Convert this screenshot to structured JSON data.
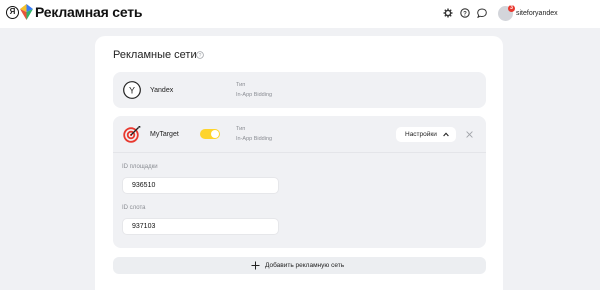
{
  "header": {
    "logo_letter": "Я",
    "title": "Рекламная сеть",
    "icons": [
      "gear-icon",
      "help-icon",
      "chat-icon"
    ],
    "avatar_badge": "3",
    "username": "siteforyandex"
  },
  "section": {
    "title": "Рекламные сети"
  },
  "networks": [
    {
      "logo_letter": "Y",
      "name": "Yandex",
      "type_label": "Тип",
      "type_value": "In-App Bidding"
    },
    {
      "name": "MyTarget",
      "enabled": true,
      "type_label": "Тип",
      "type_value": "In-App Bidding",
      "settings_label": "Настройки",
      "fields": [
        {
          "label": "ID площадки",
          "value": "936510"
        },
        {
          "label": "ID слота",
          "value": "937103"
        }
      ]
    }
  ],
  "add_button": {
    "label": "Добавить рекламную сеть"
  },
  "colors": {
    "toggle_on": "#fed42b",
    "background": "#f0f1f4",
    "badge": "#e8382e",
    "mytarget_logo": "#e8382e"
  }
}
